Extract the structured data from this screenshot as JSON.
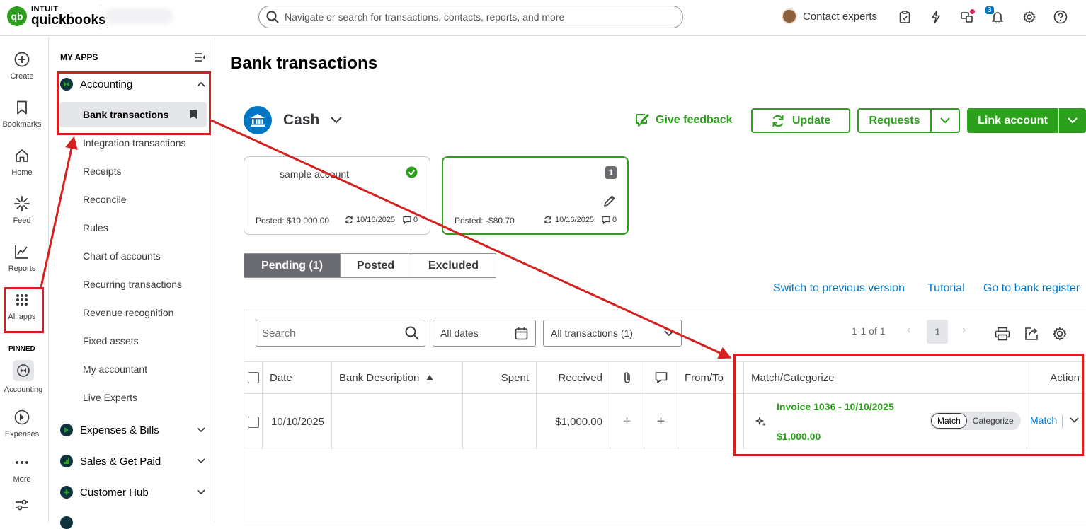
{
  "brand": {
    "company": "INTUIT",
    "product": "quickbooks",
    "logo_mark": "qb"
  },
  "topbar": {
    "search_placeholder": "Navigate or search for transactions, contacts, reports, and more",
    "contact_experts": "Contact experts",
    "notification_count": "3"
  },
  "rail": {
    "create": "Create",
    "bookmarks": "Bookmarks",
    "home": "Home",
    "feed": "Feed",
    "reports": "Reports",
    "all_apps": "All apps",
    "pinned": "PINNED",
    "accounting": "Accounting",
    "expenses": "Expenses",
    "more": "More"
  },
  "appmenu": {
    "title": "MY APPS",
    "accounting": "Accounting",
    "active_item": "Bank transactions",
    "items": [
      "Integration transactions",
      "Receipts",
      "Reconcile",
      "Rules",
      "Chart of accounts",
      "Recurring transactions",
      "Revenue recognition",
      "Fixed assets",
      "My accountant",
      "Live Experts"
    ],
    "sections": [
      "Expenses & Bills",
      "Sales & Get Paid",
      "Customer Hub"
    ]
  },
  "main": {
    "title": "Bank transactions",
    "account_name": "Cash",
    "give_feedback": "Give feedback",
    "update": "Update",
    "requests": "Requests",
    "link_account": "Link account",
    "cards": [
      {
        "name": "sample account",
        "posted": "Posted: $10,000.00",
        "synced": "10/16/2025",
        "comments": "0"
      },
      {
        "name": "",
        "badge": "1",
        "posted": "Posted: -$80.70",
        "synced": "10/16/2025",
        "comments": "0"
      }
    ],
    "tabs": [
      "Pending (1)",
      "Posted",
      "Excluded"
    ],
    "links": [
      "Switch to previous version",
      "Tutorial",
      "Go to bank register"
    ]
  },
  "table": {
    "search_placeholder": "Search",
    "date_filter": "All dates",
    "type_filter": "All transactions (1)",
    "pager_text": "1-1 of 1",
    "page": "1",
    "columns": [
      "Date",
      "Bank Description",
      "Spent",
      "Received",
      "From/To",
      "Match/Categorize",
      "Action"
    ],
    "rows": [
      {
        "date": "10/10/2025",
        "description": "",
        "spent": "",
        "received": "$1,000.00",
        "match_title": "Invoice 1036 - 10/10/2025",
        "match_amount": "$1,000.00",
        "seg_match": "Match",
        "seg_categorize": "Categorize",
        "action": "Match"
      }
    ]
  },
  "colors": {
    "brand_green": "#2ca01c",
    "link_blue": "#0077c5",
    "annotation_red": "#d52020"
  }
}
